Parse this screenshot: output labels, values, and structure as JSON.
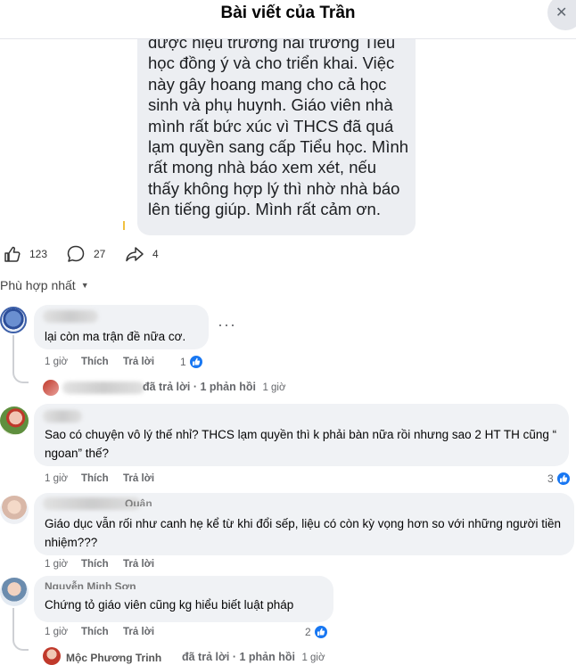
{
  "header": {
    "title": "Bài viết của Trần",
    "close_icon": "close-icon"
  },
  "post": {
    "text": "được hiệu trưởng hai trường Tiểu học đồng ý và cho triển khai. Việc này gây hoang mang cho cả học sinh và phụ huynh. Giáo viên nhà mình rất bức xúc vì THCS đã quá lạm quyền sang cấp Tiểu học. Mình rất mong nhà báo xem xét, nếu thấy không hợp lý thì nhờ nhà báo lên tiếng giúp. Mình rất cảm ơn."
  },
  "actions": {
    "likes": "123",
    "comments": "27",
    "shares": "4"
  },
  "sort": {
    "label": "Phù hợp nhất"
  },
  "comments": [
    {
      "text": "lại còn ma trận đề nữa cơ.",
      "time": "1 giờ",
      "like_label": "Thích",
      "reply_label": "Trả lời",
      "reactions": "1",
      "replies_summary": "đã trả lời · 1 phản hồi",
      "replies_time": "1 giờ"
    },
    {
      "text": "Sao có chuyện vô lý thế nhỉ? THCS lạm quyền thì k phải bàn nữa rồi nhưng sao 2 HT TH cũng “ ngoan” thế?",
      "time": "1 giờ",
      "like_label": "Thích",
      "reply_label": "Trả lời",
      "reactions": "3"
    },
    {
      "name_partial": "Quân",
      "text": "Giáo dục vẫn rối như canh hẹ kể từ khi đổi sếp, liệu có còn kỳ vọng hơn so với những người tiền nhiệm???",
      "time": "1 giờ",
      "like_label": "Thích",
      "reply_label": "Trả lời"
    },
    {
      "name": "Nguyễn Minh Sơn",
      "text": "Chứng tỏ giáo viên cũng kg hiểu biết luật pháp",
      "time": "1 giờ",
      "like_label": "Thích",
      "reply_label": "Trả lời",
      "reactions": "2",
      "reply_author": "Mộc Phương Trinh",
      "replies_summary": "đã trả lời · 1 phản hồi",
      "replies_time": "1 giờ"
    }
  ],
  "colors": {
    "like_blue": "#1877f2",
    "bubble": "#f0f2f5",
    "meta": "#65676b"
  }
}
